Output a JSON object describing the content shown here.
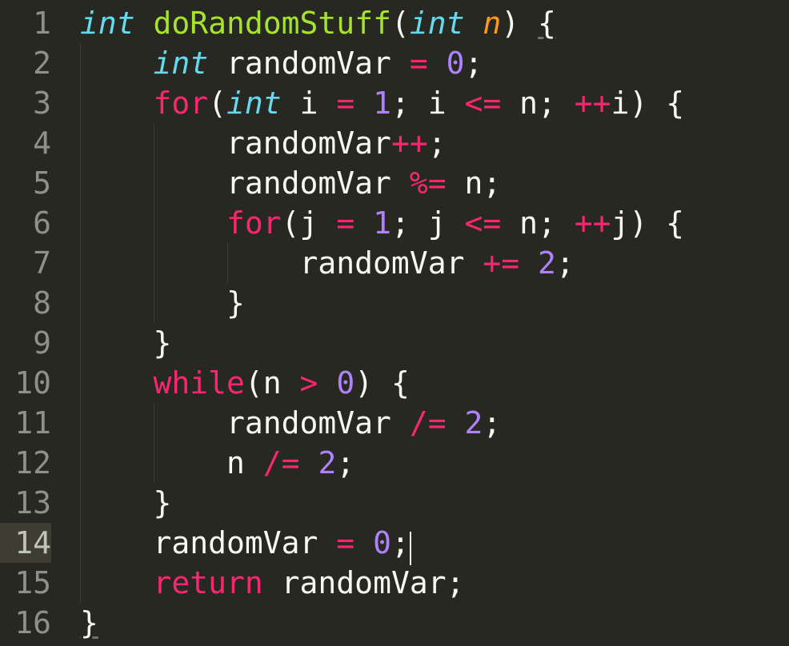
{
  "editor": {
    "current_line": 14,
    "caret_col_after": "randomVar = 0;",
    "indent_unit": 4,
    "lines": [
      {
        "num": "1",
        "indent": 0,
        "tokens": [
          {
            "t": "type",
            "v": "int"
          },
          {
            "t": "pln",
            "v": " "
          },
          {
            "t": "fn",
            "v": "doRandomStuff"
          },
          {
            "t": "pln",
            "v": "("
          },
          {
            "t": "type",
            "v": "int"
          },
          {
            "t": "pln",
            "v": " "
          },
          {
            "t": "prm",
            "v": "n"
          },
          {
            "t": "pln",
            "v": ") "
          },
          {
            "t": "pln",
            "v": "{",
            "cls": "brace-underline"
          }
        ]
      },
      {
        "num": "2",
        "indent": 1,
        "tokens": [
          {
            "t": "type",
            "v": "int"
          },
          {
            "t": "pln",
            "v": " randomVar "
          },
          {
            "t": "kw",
            "v": "="
          },
          {
            "t": "pln",
            "v": " "
          },
          {
            "t": "num",
            "v": "0"
          },
          {
            "t": "pln",
            "v": ";"
          }
        ]
      },
      {
        "num": "3",
        "indent": 1,
        "tokens": [
          {
            "t": "kw",
            "v": "for"
          },
          {
            "t": "pln",
            "v": "("
          },
          {
            "t": "type",
            "v": "int"
          },
          {
            "t": "pln",
            "v": " i "
          },
          {
            "t": "kw",
            "v": "="
          },
          {
            "t": "pln",
            "v": " "
          },
          {
            "t": "num",
            "v": "1"
          },
          {
            "t": "pln",
            "v": "; i "
          },
          {
            "t": "kw",
            "v": "<="
          },
          {
            "t": "pln",
            "v": " n; "
          },
          {
            "t": "kw",
            "v": "++"
          },
          {
            "t": "pln",
            "v": "i) {"
          }
        ]
      },
      {
        "num": "4",
        "indent": 2,
        "tokens": [
          {
            "t": "pln",
            "v": "randomVar"
          },
          {
            "t": "kw",
            "v": "++"
          },
          {
            "t": "pln",
            "v": ";"
          }
        ]
      },
      {
        "num": "5",
        "indent": 2,
        "tokens": [
          {
            "t": "pln",
            "v": "randomVar "
          },
          {
            "t": "kw",
            "v": "%="
          },
          {
            "t": "pln",
            "v": " n;"
          }
        ]
      },
      {
        "num": "6",
        "indent": 2,
        "tokens": [
          {
            "t": "kw",
            "v": "for"
          },
          {
            "t": "pln",
            "v": "(j "
          },
          {
            "t": "kw",
            "v": "="
          },
          {
            "t": "pln",
            "v": " "
          },
          {
            "t": "num",
            "v": "1"
          },
          {
            "t": "pln",
            "v": "; j "
          },
          {
            "t": "kw",
            "v": "<="
          },
          {
            "t": "pln",
            "v": " n; "
          },
          {
            "t": "kw",
            "v": "++"
          },
          {
            "t": "pln",
            "v": "j) {"
          }
        ]
      },
      {
        "num": "7",
        "indent": 3,
        "tokens": [
          {
            "t": "pln",
            "v": "randomVar "
          },
          {
            "t": "kw",
            "v": "+="
          },
          {
            "t": "pln",
            "v": " "
          },
          {
            "t": "num",
            "v": "2"
          },
          {
            "t": "pln",
            "v": ";"
          }
        ]
      },
      {
        "num": "8",
        "indent": 2,
        "tokens": [
          {
            "t": "pln",
            "v": "}"
          }
        ]
      },
      {
        "num": "9",
        "indent": 1,
        "tokens": [
          {
            "t": "pln",
            "v": "}"
          }
        ]
      },
      {
        "num": "10",
        "indent": 1,
        "tokens": [
          {
            "t": "kw",
            "v": "while"
          },
          {
            "t": "pln",
            "v": "(n "
          },
          {
            "t": "kw",
            "v": ">"
          },
          {
            "t": "pln",
            "v": " "
          },
          {
            "t": "num",
            "v": "0"
          },
          {
            "t": "pln",
            "v": ") {"
          }
        ]
      },
      {
        "num": "11",
        "indent": 2,
        "tokens": [
          {
            "t": "pln",
            "v": "randomVar "
          },
          {
            "t": "kw",
            "v": "/="
          },
          {
            "t": "pln",
            "v": " "
          },
          {
            "t": "num",
            "v": "2"
          },
          {
            "t": "pln",
            "v": ";"
          }
        ]
      },
      {
        "num": "12",
        "indent": 2,
        "tokens": [
          {
            "t": "pln",
            "v": "n "
          },
          {
            "t": "kw",
            "v": "/="
          },
          {
            "t": "pln",
            "v": " "
          },
          {
            "t": "num",
            "v": "2"
          },
          {
            "t": "pln",
            "v": ";"
          }
        ]
      },
      {
        "num": "13",
        "indent": 1,
        "tokens": [
          {
            "t": "pln",
            "v": "}"
          }
        ]
      },
      {
        "num": "14",
        "indent": 1,
        "current": true,
        "caret_after": true,
        "tokens": [
          {
            "t": "pln",
            "v": "randomVar "
          },
          {
            "t": "kw",
            "v": "="
          },
          {
            "t": "pln",
            "v": " "
          },
          {
            "t": "num",
            "v": "0"
          },
          {
            "t": "pln",
            "v": ";"
          }
        ]
      },
      {
        "num": "15",
        "indent": 1,
        "tokens": [
          {
            "t": "kw",
            "v": "return"
          },
          {
            "t": "pln",
            "v": " randomVar;"
          }
        ]
      },
      {
        "num": "16",
        "indent": 0,
        "tokens": [
          {
            "t": "pln",
            "v": "}",
            "cls": "brace-underline"
          }
        ]
      }
    ]
  }
}
